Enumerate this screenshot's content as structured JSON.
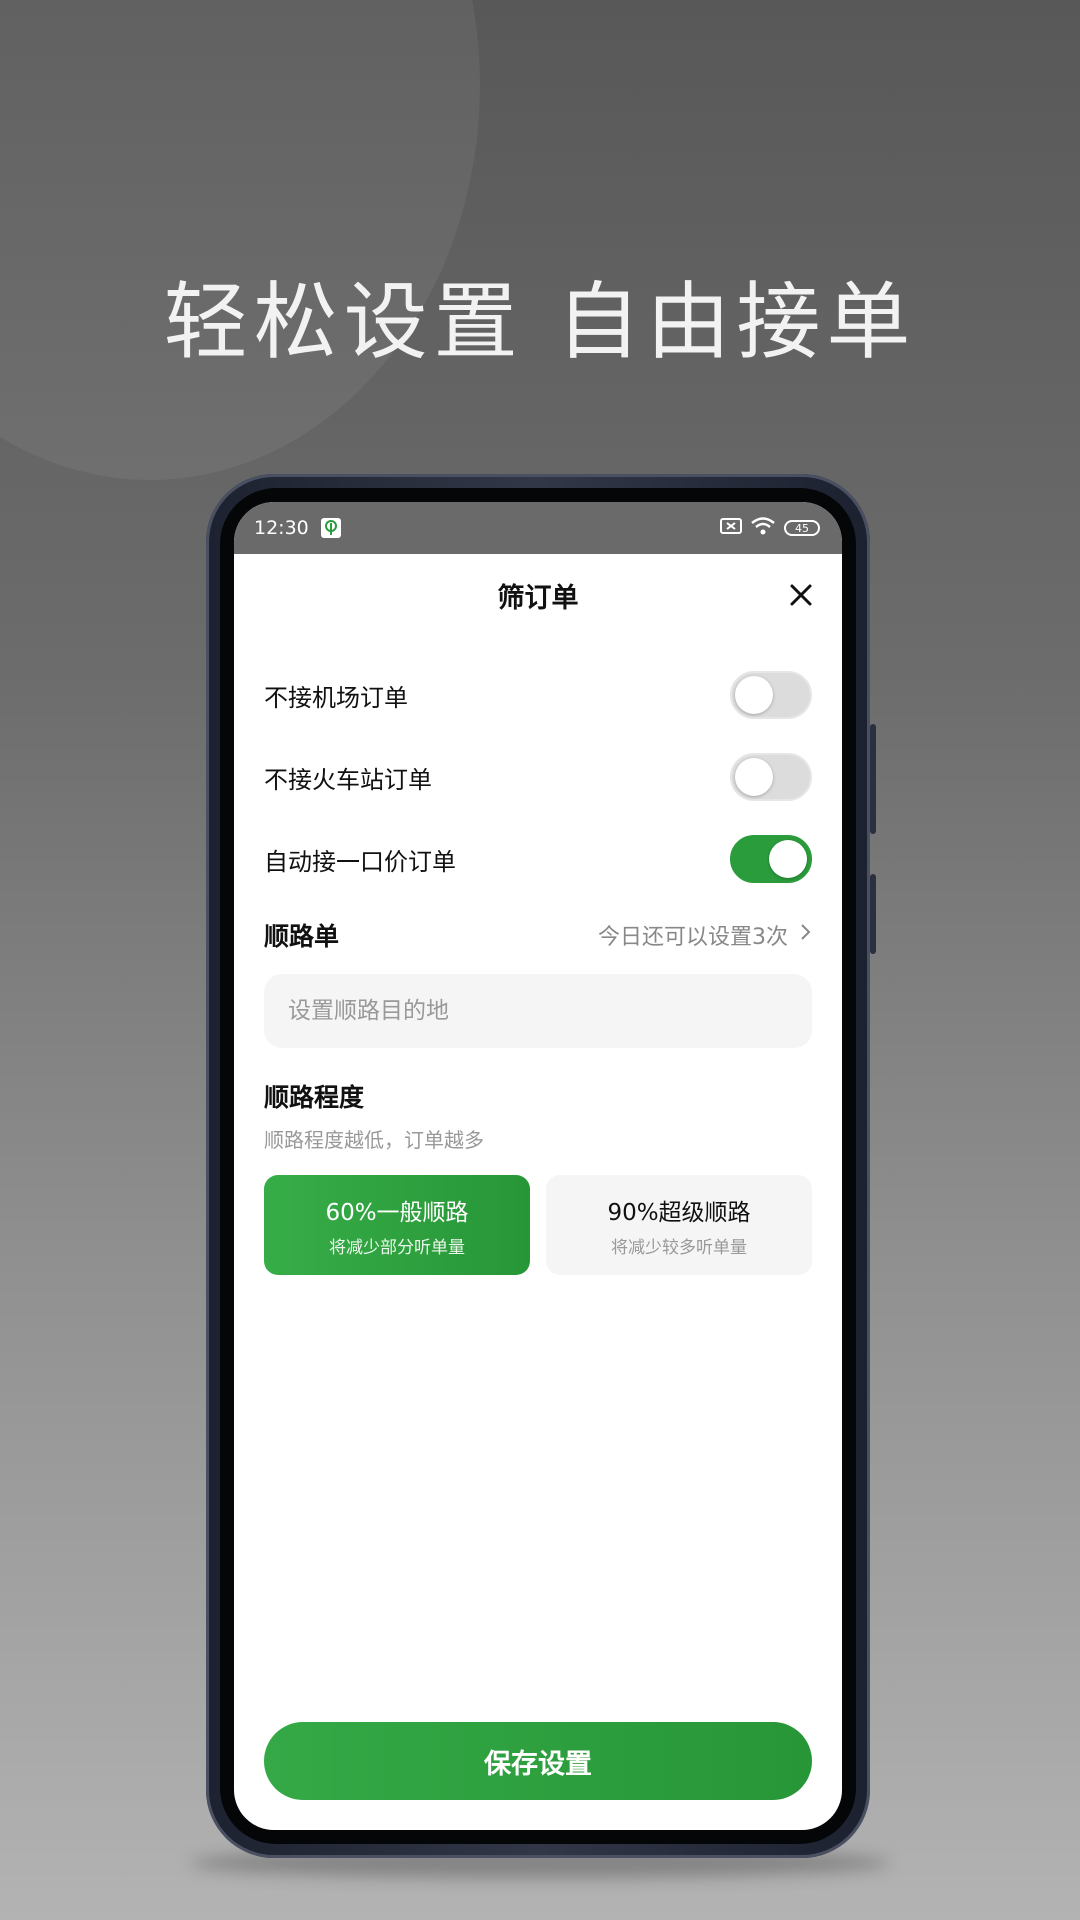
{
  "headline": "轻松设置 自由接单",
  "status_bar": {
    "time": "12:30",
    "battery": "45"
  },
  "dialog": {
    "title": "筛订单",
    "toggles": [
      {
        "label": "不接机场订单",
        "on": false
      },
      {
        "label": "不接火车站订单",
        "on": false
      },
      {
        "label": "自动接一口价订单",
        "on": true
      }
    ],
    "route": {
      "title": "顺路单",
      "link_text": "今日还可以设置3次",
      "input_value": "",
      "input_placeholder": "设置顺路目的地"
    },
    "degree": {
      "title": "顺路程度",
      "subtitle": "顺路程度越低，订单越多",
      "options": [
        {
          "label": "60%一般顺路",
          "desc": "将减少部分听单量",
          "selected": true
        },
        {
          "label": "90%超级顺路",
          "desc": "将减少较多听单量",
          "selected": false
        }
      ]
    },
    "save_label": "保存设置"
  },
  "colors": {
    "accent": "#2b9c3c",
    "toggle_off": "#dcdcdc"
  },
  "icons": [
    "app-leaf-icon",
    "sim-icon",
    "wifi-icon",
    "battery-icon",
    "close-icon",
    "chevron-right-icon"
  ]
}
